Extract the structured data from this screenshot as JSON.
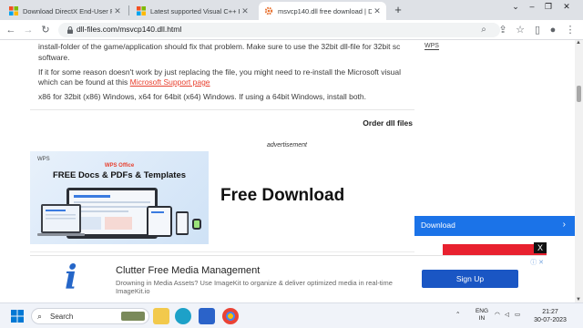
{
  "browser": {
    "tabs": [
      {
        "title": "Download DirectX End-User Runti",
        "active": false,
        "favicon": "microsoft-icon"
      },
      {
        "title": "Latest supported Visual C++ Red",
        "active": false,
        "favicon": "microsoft-icon"
      },
      {
        "title": "msvcp140.dll free download | DL",
        "active": true,
        "favicon": "gear-icon"
      }
    ],
    "new_tab": "+",
    "window_controls": {
      "minimize": "–",
      "restore": "❐",
      "close": "✕"
    },
    "url": "dll-files.com/msvcp140.dll.html"
  },
  "article": {
    "line1": "install-folder of the game/application should fix that problem. Make sure to use the 32bit dll-file for 32bit sc",
    "line2": "software.",
    "line3": "If it for some reason doesn't work by just replacing the file, you might need to re-install the Microsoft visual",
    "line4_prefix": "which can be found at this ",
    "line4_link": "Microsoft Support page",
    "line5": "x86 for 32bit (x86) Windows, x64 for 64bit (x64) Windows. If using a 64bit Windows, install both."
  },
  "order_dll_files": "Order dll files",
  "advertisement_label": "advertisement",
  "wps_ad": {
    "brand": "WPS",
    "product": "WPS Office",
    "headline": "FREE Docs & PDFs & Templates",
    "cta": "Free Download"
  },
  "sidebar": {
    "wps_label": "WPS",
    "download_label": "Download",
    "close": "X"
  },
  "banner": {
    "title": "Clutter Free Media Management",
    "desc_line1": "Drowning in Media Assets? Use ImageKit to organize & deliver optimized media in real-time",
    "desc_line2": "ImageKit.io",
    "cta": "Sign Up",
    "logo": "i"
  },
  "taskbar": {
    "search_label": "Search",
    "lang_top": "ENG",
    "lang_bottom": "IN",
    "time": "21:27",
    "date": "30-07-2023"
  },
  "colors": {
    "link": "#e8402f",
    "download_bar": "#1b73e8",
    "signup": "#1a56c4"
  }
}
